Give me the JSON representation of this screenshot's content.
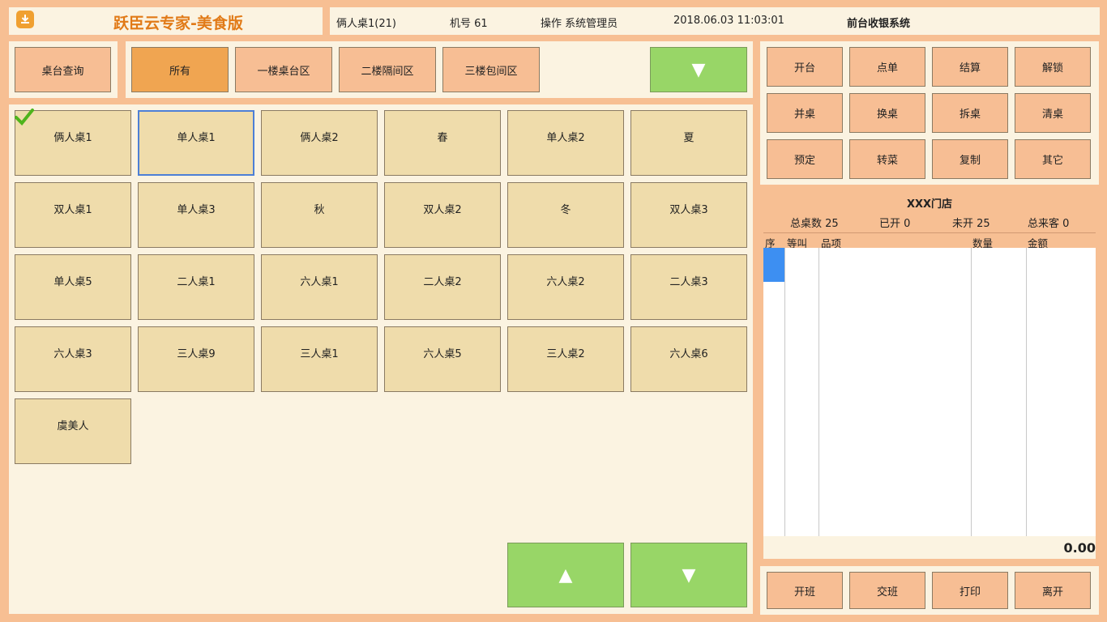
{
  "header": {
    "app_title": "跃臣云专家-美食版",
    "table_info": "俩人桌1(21)",
    "machine": "机号 61",
    "operator": "操作  系统管理员",
    "datetime": "2018.06.03 11:03:01",
    "system_name": "前台收银系统"
  },
  "filters": {
    "query": "桌台查询",
    "tabs": [
      "所有",
      "一楼桌台区",
      "二楼隔间区",
      "三楼包间区"
    ],
    "active_tab": "所有",
    "more_icon": "▼"
  },
  "tables": [
    "俩人桌1",
    "单人桌1",
    "俩人桌2",
    "春",
    "单人桌2",
    "夏",
    "双人桌1",
    "单人桌3",
    "秋",
    "双人桌2",
    "冬",
    "双人桌3",
    "单人桌5",
    "二人桌1",
    "六人桌1",
    "二人桌2",
    "六人桌2",
    "二人桌3",
    "六人桌3",
    "三人桌9",
    "三人桌1",
    "六人桌5",
    "三人桌2",
    "六人桌6",
    "虞美人"
  ],
  "selected_table": "单人桌1",
  "checked_table": "俩人桌1",
  "pager": {
    "up": "▲",
    "down": "▼"
  },
  "actions": [
    "开台",
    "点单",
    "结算",
    "解锁",
    "并桌",
    "换桌",
    "拆桌",
    "清桌",
    "预定",
    "转菜",
    "复制",
    "其它"
  ],
  "store": {
    "name": "XXX门店",
    "total": "总桌数 25",
    "opened": "已开 0",
    "unopened": "未开 25",
    "guests": "总来客  0"
  },
  "order_columns": [
    "序",
    "等叫",
    "品项",
    "数量",
    "金额"
  ],
  "order_total": "0.00",
  "bottom_actions": [
    "开班",
    "交班",
    "打印",
    "离开"
  ],
  "colors": {
    "accent": "#e17a17",
    "tile": "#efdcab",
    "green": "#98d667",
    "selection": "#4d7fd6"
  }
}
